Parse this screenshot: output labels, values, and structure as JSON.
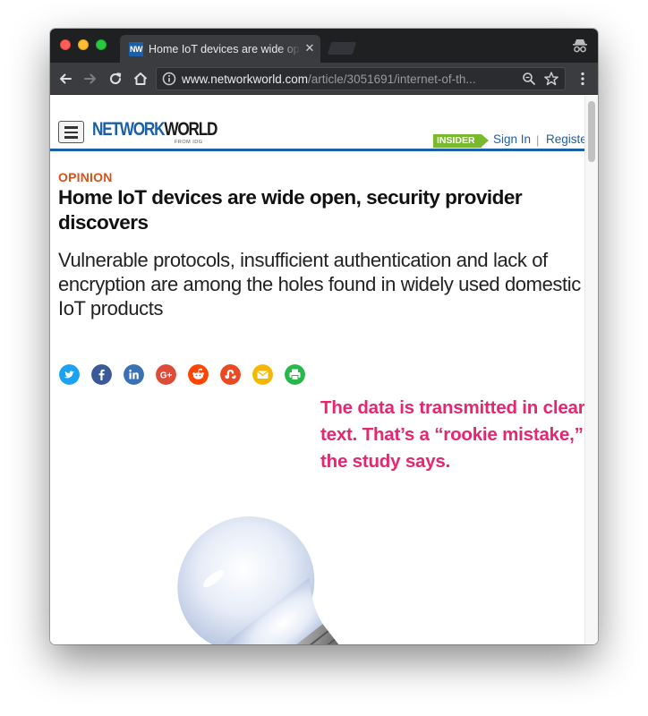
{
  "browser": {
    "tab": {
      "favicon_text": "NW",
      "title": "Home IoT devices are wide open",
      "close_glyph": "✕"
    },
    "toolbar": {
      "url_domain": "www.networkworld.com",
      "url_path": "/article/3051691/internet-of-th...",
      "icons": [
        "back-arrow-icon",
        "forward-arrow-icon",
        "reload-icon",
        "home-icon",
        "info-icon",
        "zoom-icon",
        "star-icon",
        "menu-dots-icon",
        "incognito-icon"
      ]
    }
  },
  "site": {
    "logo_network": "NETWORK",
    "logo_world": "WORLD",
    "logo_sub": "FROM IDG",
    "insider_label": "INSIDER",
    "signin_label": "Sign In",
    "separator": "|",
    "register_label": "Register"
  },
  "article": {
    "kicker": "OPINION",
    "headline": "Home IoT devices are wide open, security provider discovers",
    "dek": "Vulnerable protocols, insufficient authentication and lack of encryption are among the holes found in widely used domestic IoT products",
    "share_icons": [
      {
        "name": "twitter-icon",
        "color": "#1da1f2"
      },
      {
        "name": "facebook-icon",
        "color": "#3b5998"
      },
      {
        "name": "linkedin-icon",
        "color": "#3a70b5"
      },
      {
        "name": "google-plus-icon",
        "color": "#dd4b39"
      },
      {
        "name": "reddit-icon",
        "color": "#ff4500"
      },
      {
        "name": "stumbleupon-icon",
        "color": "#eb4924"
      },
      {
        "name": "email-icon",
        "color": "#f5b800"
      },
      {
        "name": "print-icon",
        "color": "#26b84a"
      }
    ]
  },
  "annotation": {
    "text": "The data is transmitted in clear text. That’s a “rookie mistake,” the study says.",
    "color": "#e6266f"
  },
  "colors": {
    "brand_blue": "#1b5fa8",
    "kicker_orange": "#d2541c",
    "insider_green": "#7ab92d"
  }
}
